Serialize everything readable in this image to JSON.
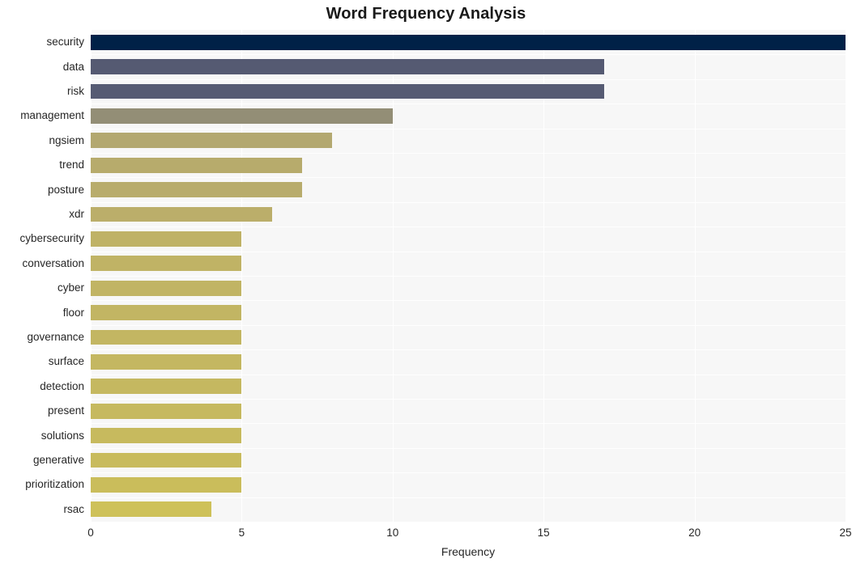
{
  "chart_data": {
    "type": "bar",
    "orientation": "horizontal",
    "title": "Word Frequency Analysis",
    "xlabel": "Frequency",
    "ylabel": "",
    "categories": [
      "security",
      "data",
      "risk",
      "management",
      "ngsiem",
      "trend",
      "posture",
      "xdr",
      "cybersecurity",
      "conversation",
      "cyber",
      "floor",
      "governance",
      "surface",
      "detection",
      "present",
      "solutions",
      "generative",
      "prioritization",
      "rsac"
    ],
    "values": [
      25,
      17,
      17,
      10,
      8,
      7,
      7,
      6,
      5,
      5,
      5,
      5,
      5,
      5,
      5,
      5,
      5,
      5,
      5,
      4
    ],
    "bar_colors": [
      "#002147",
      "#555a72",
      "#565b73",
      "#938e76",
      "#b3a870",
      "#b7ab6c",
      "#b8ac6c",
      "#bbae6a",
      "#bfb266",
      "#c0b365",
      "#c1b464",
      "#c2b563",
      "#c3b662",
      "#c4b761",
      "#c5b860",
      "#c6b95f",
      "#c7ba5e",
      "#c8bb5d",
      "#cabd5b",
      "#cec159"
    ],
    "xticks": [
      0,
      5,
      10,
      15,
      20,
      25
    ],
    "xtick_labels": [
      "0",
      "5",
      "10",
      "15",
      "20",
      "25"
    ],
    "xlim": [
      0,
      25
    ],
    "grid": true,
    "legend": false,
    "plot_background": "#f7f7f7",
    "figure_background": "#ffffff",
    "gridline_color": "#ffffff",
    "text_color": "#262626",
    "title_color": "#1a1a1a"
  }
}
